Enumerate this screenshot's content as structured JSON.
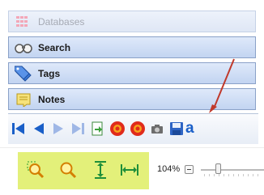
{
  "sidebar": {
    "items": [
      {
        "label": "Databases",
        "icon": "databases-icon",
        "state": "faded"
      },
      {
        "label": "Search",
        "icon": "search-binoculars-icon"
      },
      {
        "label": "Tags",
        "icon": "tags-icon"
      },
      {
        "label": "Notes",
        "icon": "notes-icon"
      }
    ]
  },
  "toolbar": {
    "items": [
      "first-page",
      "previous-page",
      "next-page",
      "last-page",
      "export",
      "red-record-1",
      "red-record-2",
      "camera",
      "save",
      "text-a"
    ],
    "partial_text": "a"
  },
  "zoom": {
    "tools": [
      "zoom-selection",
      "zoom-in",
      "fit-height",
      "fit-width"
    ],
    "percent": "104%",
    "level": 104
  },
  "colors": {
    "highlight": "#e3f07a",
    "nav_bar": "#1a5fc8",
    "annotation_arrow": "#c0392b"
  }
}
